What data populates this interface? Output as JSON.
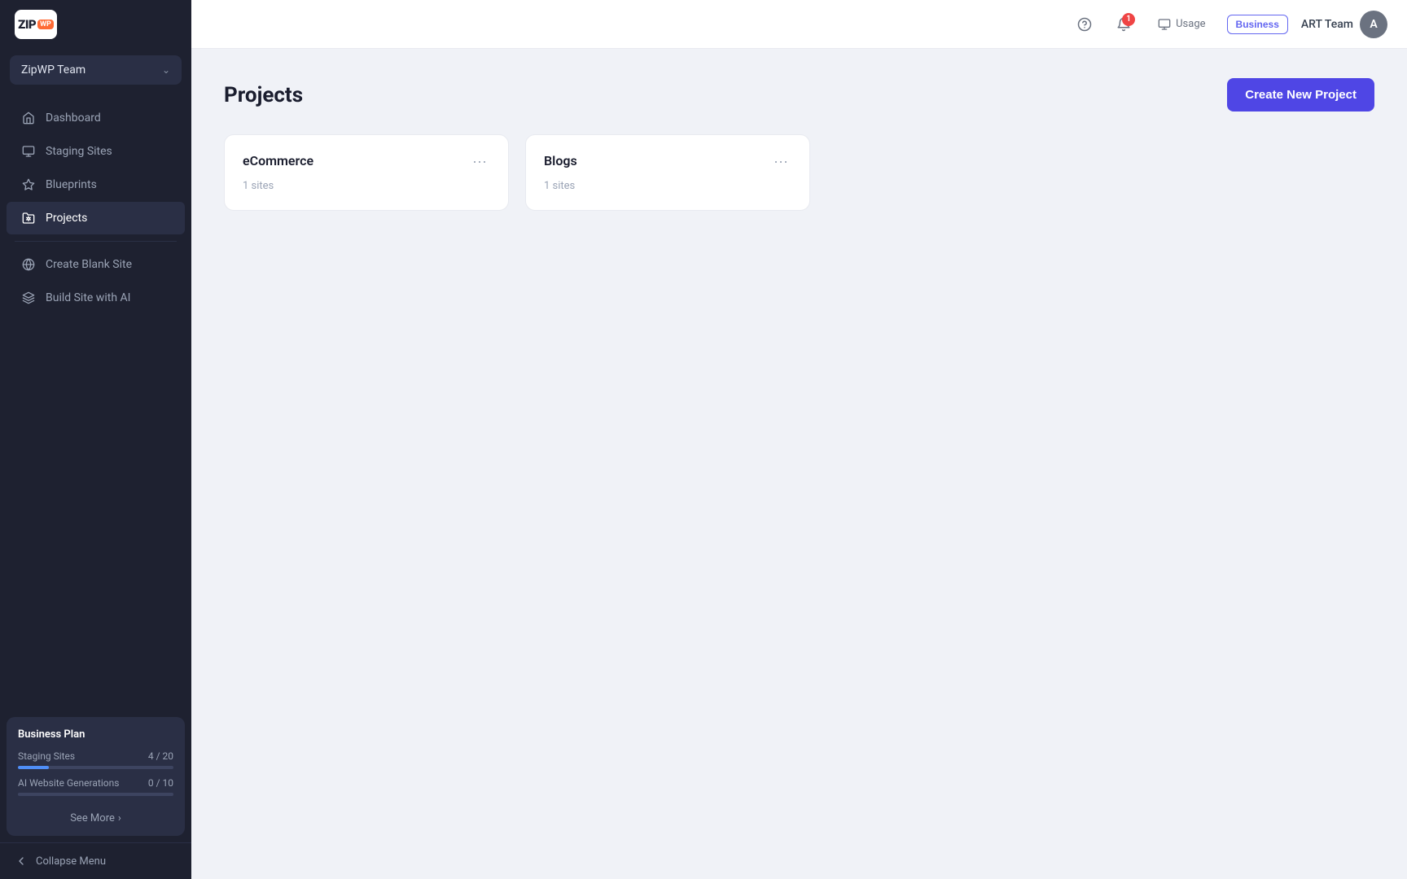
{
  "sidebar": {
    "logo_text": "ZIP",
    "logo_wp": "WP",
    "team_name": "ZipWP Team",
    "nav_items": [
      {
        "id": "dashboard",
        "label": "Dashboard",
        "active": false
      },
      {
        "id": "staging-sites",
        "label": "Staging Sites",
        "active": false
      },
      {
        "id": "blueprints",
        "label": "Blueprints",
        "active": false
      },
      {
        "id": "projects",
        "label": "Projects",
        "active": true
      }
    ],
    "action_items": [
      {
        "id": "create-blank-site",
        "label": "Create Blank Site"
      },
      {
        "id": "build-site-ai",
        "label": "Build Site with AI"
      }
    ],
    "plan": {
      "title": "Business Plan",
      "staging_sites_label": "Staging Sites",
      "staging_sites_value": "4 / 20",
      "staging_sites_percent": 20,
      "ai_gen_label": "AI Website Generations",
      "ai_gen_value": "0 / 10",
      "ai_gen_percent": 0,
      "see_more": "See More"
    },
    "collapse_label": "Collapse Menu"
  },
  "header": {
    "usage_label": "Usage",
    "business_badge": "Business",
    "user_name": "ART Team",
    "notification_count": "1"
  },
  "main": {
    "page_title": "Projects",
    "create_button": "Create New Project",
    "projects": [
      {
        "id": "ecommerce",
        "name": "eCommerce",
        "sites_count": "1 sites"
      },
      {
        "id": "blogs",
        "name": "Blogs",
        "sites_count": "1 sites"
      }
    ]
  }
}
